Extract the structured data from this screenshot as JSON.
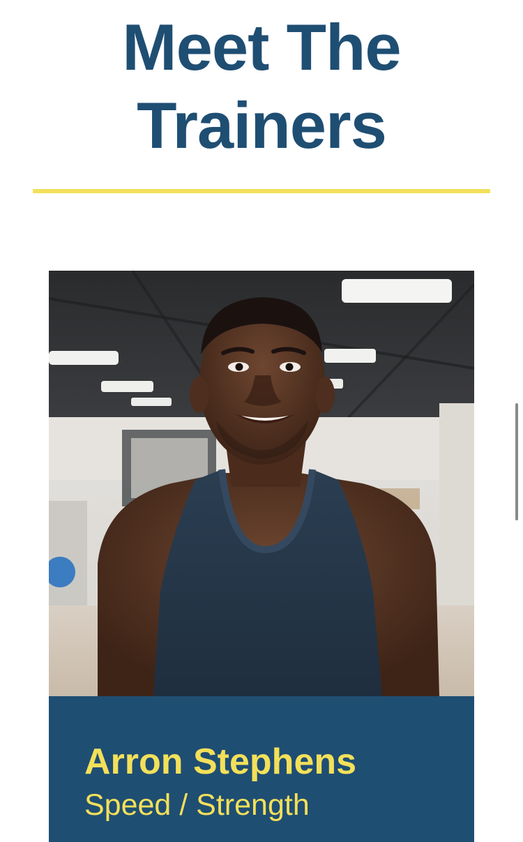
{
  "section": {
    "title_line1": "Meet The",
    "title_line2": "Trainers"
  },
  "trainer": {
    "name": "Arron Stephens",
    "specialty": "Speed / Strength",
    "photo_icon": "trainer-portrait-image"
  },
  "colors": {
    "navy": "#1f4e73",
    "accent_yellow": "#f3e05a",
    "background": "#ffffff",
    "scrollbar": "#8a8a8a"
  }
}
